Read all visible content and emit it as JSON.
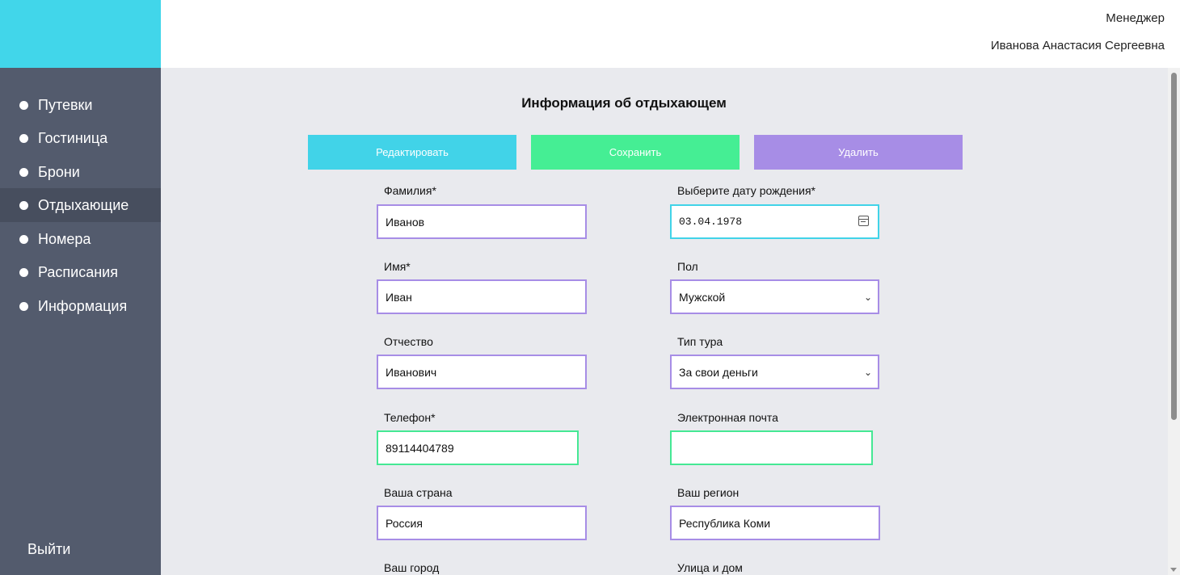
{
  "header": {
    "role": "Менеджер",
    "user_name": "Иванова Анастасия Сергеевна"
  },
  "sidebar": {
    "items": [
      {
        "label": "Путевки"
      },
      {
        "label": "Гостиница"
      },
      {
        "label": "Брони"
      },
      {
        "label": "Отдыхающие"
      },
      {
        "label": "Номера"
      },
      {
        "label": "Расписания"
      },
      {
        "label": "Информация"
      }
    ],
    "active_item": "Отдыхающие",
    "logout": "Выйти"
  },
  "main": {
    "title": "Информация об отдыхающем",
    "buttons": {
      "edit": "Редактировать",
      "save": "Сохранить",
      "delete": "Удалить"
    },
    "form": {
      "last_name": {
        "label": "Фамилия*",
        "value": "Иванов"
      },
      "birth_date": {
        "label": "Выберите дату рождения*",
        "value": "03.04.1978"
      },
      "first_name": {
        "label": "Имя*",
        "value": "Иван"
      },
      "gender": {
        "label": "Пол",
        "value": "Мужской"
      },
      "patronymic": {
        "label": "Отчество",
        "value": "Иванович"
      },
      "tour_type": {
        "label": "Тип тура",
        "value": "За свои деньги"
      },
      "phone": {
        "label": "Телефон*",
        "value": "89114404789"
      },
      "email": {
        "label": "Электронная почта",
        "value": ""
      },
      "country": {
        "label": "Ваша страна",
        "value": "Россия"
      },
      "region": {
        "label": "Ваш регион",
        "value": "Республика Коми"
      },
      "city": {
        "label": "Ваш город"
      },
      "street": {
        "label": "Улица и дом"
      }
    }
  },
  "colors": {
    "accent_cyan": "#41d3e8",
    "accent_green": "#45ee94",
    "accent_purple": "#a78de6",
    "sidebar_bg": "#535b6d",
    "main_bg": "#e9eaee"
  }
}
